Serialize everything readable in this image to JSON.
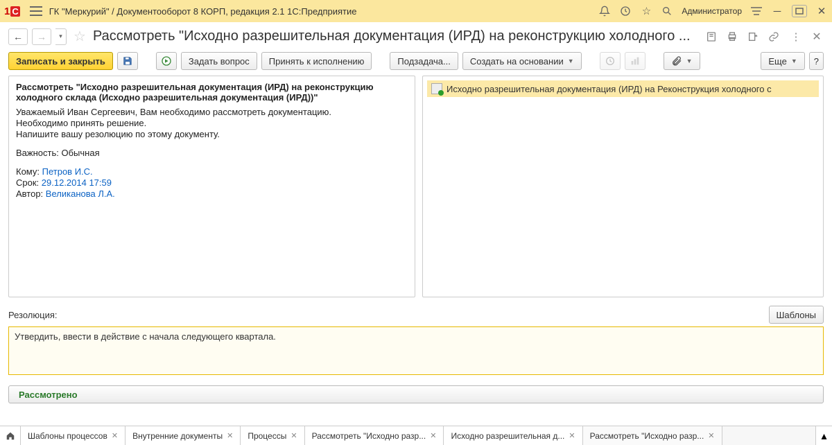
{
  "titlebar": {
    "title": "ГК \"Меркурий\" / Документооборот 8 КОРП, редакция 2.1 1С:Предприятие",
    "admin": "Администратор"
  },
  "page": {
    "title": "Рассмотреть \"Исходно разрешительная документация (ИРД) на реконструкцию холодного ..."
  },
  "toolbar": {
    "save_close": "Записать и закрыть",
    "ask": "Задать вопрос",
    "accept": "Принять к исполнению",
    "subtask": "Подзадача...",
    "create_based": "Создать на основании",
    "more": "Еще",
    "help": "?"
  },
  "task": {
    "title": "Рассмотреть \"Исходно разрешительная документация (ИРД) на реконструкцию холодного склада (Исходно разрешительная документация (ИРД))\"",
    "line1": "Уважаемый Иван Сергеевич, Вам необходимо рассмотреть документацию.",
    "line2": "Необходимо принять решение.",
    "line3": "Напишите вашу резолюцию по этому документу.",
    "importance_label": "Важность:",
    "importance_value": "Обычная",
    "to_label": "Кому:",
    "to_value": "Петров И.С.",
    "due_label": "Срок:",
    "due_value": "29.12.2014 17:59",
    "author_label": "Автор:",
    "author_value": "Великанова Л.А."
  },
  "attachment": {
    "name": "Исходно разрешительная документация (ИРД) на Реконструкция холодного с"
  },
  "resolution": {
    "label": "Резолюция:",
    "templates_btn": "Шаблоны",
    "value": "Утвердить, ввести в действие с начала следующего квартала."
  },
  "done_btn": "Рассмотрено",
  "tabs": {
    "t1": "Шаблоны процессов",
    "t2": "Внутренние документы",
    "t3": "Процессы",
    "t4": "Рассмотреть \"Исходно разр...",
    "t5": "Исходно разрешительная д...",
    "t6": "Рассмотреть \"Исходно разр..."
  }
}
